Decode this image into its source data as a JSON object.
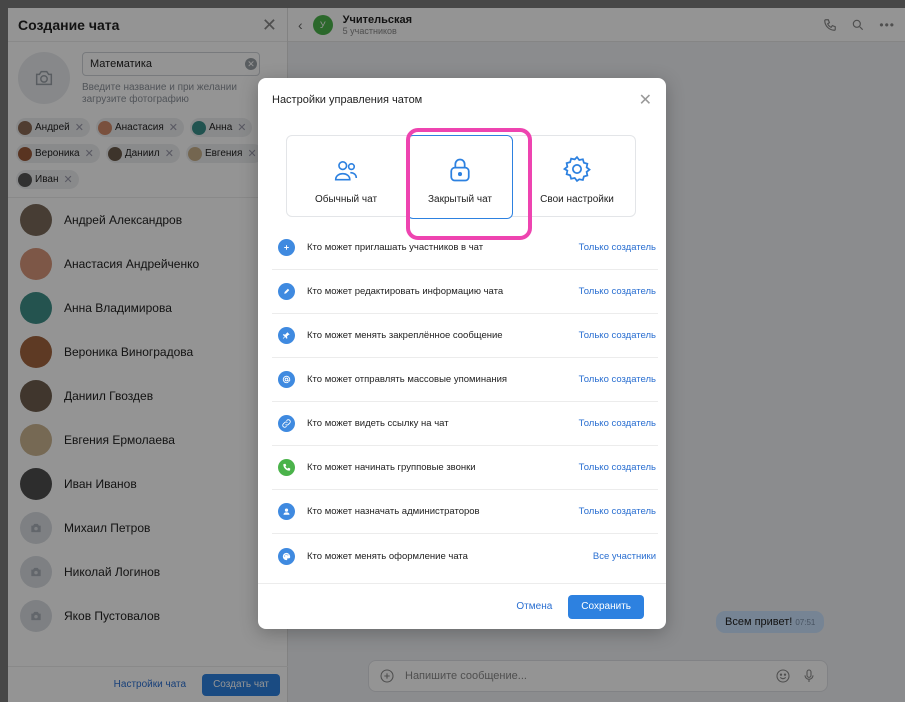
{
  "left": {
    "title": "Создание чата",
    "name_value": "Математика",
    "name_hint": "Введите название и при желании загрузите фотографию",
    "chips": [
      {
        "name": "Андрей",
        "color": "#8a6a55"
      },
      {
        "name": "Анастасия",
        "color": "#d08a6a"
      },
      {
        "name": "Анна",
        "color": "#3a8f8a"
      },
      {
        "name": "Вероника",
        "color": "#9a5a3a"
      },
      {
        "name": "Даниил",
        "color": "#6a5a4a"
      },
      {
        "name": "Евгения",
        "color": "#c8b08a"
      },
      {
        "name": "Иван",
        "color": "#555"
      }
    ],
    "contacts": [
      {
        "name": "Андрей Александров",
        "color": "#7a6a5a"
      },
      {
        "name": "Анастасия Андрейченко",
        "color": "#d8967a"
      },
      {
        "name": "Анна Владимирова",
        "color": "#3f9088"
      },
      {
        "name": "Вероника Виноградова",
        "color": "#a3643f"
      },
      {
        "name": "Даниил Гвоздев",
        "color": "#6e5e4e"
      },
      {
        "name": "Евгения Ермолаева",
        "color": "#cbb591"
      },
      {
        "name": "Иван Иванов",
        "color": "#4e4e4e"
      },
      {
        "name": "Михаил Петров",
        "color": "#d9dde2"
      },
      {
        "name": "Николай Логинов",
        "color": "#d9dde2"
      },
      {
        "name": "Яков Пустовалов",
        "color": "#d9dde2"
      }
    ],
    "settings_link": "Настройки чата",
    "create_button": "Создать чат"
  },
  "chat": {
    "avatar_letter": "У",
    "title": "Учительская",
    "subtitle": "5 участников",
    "bubble_text": "Всем привет!",
    "bubble_time": "07:51",
    "composer_placeholder": "Напишите сообщение..."
  },
  "modal": {
    "title": "Настройки управления чатом",
    "types": [
      {
        "label": "Обычный чат",
        "icon": "users-icon"
      },
      {
        "label": "Закрытый чат",
        "icon": "lock-icon"
      },
      {
        "label": "Свои настройки",
        "icon": "gear-icon"
      }
    ],
    "selected_type": "Закрытый чат",
    "settings": [
      {
        "label": "Кто может приглашать участников в чат",
        "value": "Только создатель",
        "icon": "plus-icon",
        "color": "#3f8ae0"
      },
      {
        "label": "Кто может редактировать информацию чата",
        "value": "Только создатель",
        "icon": "pencil-icon",
        "color": "#3f8ae0"
      },
      {
        "label": "Кто может менять закреплённое сообщение",
        "value": "Только создатель",
        "icon": "pin-icon",
        "color": "#3f8ae0"
      },
      {
        "label": "Кто может отправлять массовые упоминания",
        "value": "Только создатель",
        "icon": "at-icon",
        "color": "#3f8ae0"
      },
      {
        "label": "Кто может видеть ссылку на чат",
        "value": "Только создатель",
        "icon": "link-icon",
        "color": "#3f8ae0"
      },
      {
        "label": "Кто может начинать групповые звонки",
        "value": "Только создатель",
        "icon": "phone-icon",
        "color": "#4bb34b"
      },
      {
        "label": "Кто может назначать администраторов",
        "value": "Только создатель",
        "icon": "user-icon",
        "color": "#3f8ae0"
      },
      {
        "label": "Кто может менять оформление чата",
        "value": "Все участники",
        "icon": "palette-icon",
        "color": "#3f8ae0"
      }
    ],
    "cancel": "Отмена",
    "save": "Сохранить"
  },
  "colors": {
    "accent": "#2d81e0",
    "highlight": "#ee44b0",
    "link": "#2a6fd1"
  }
}
